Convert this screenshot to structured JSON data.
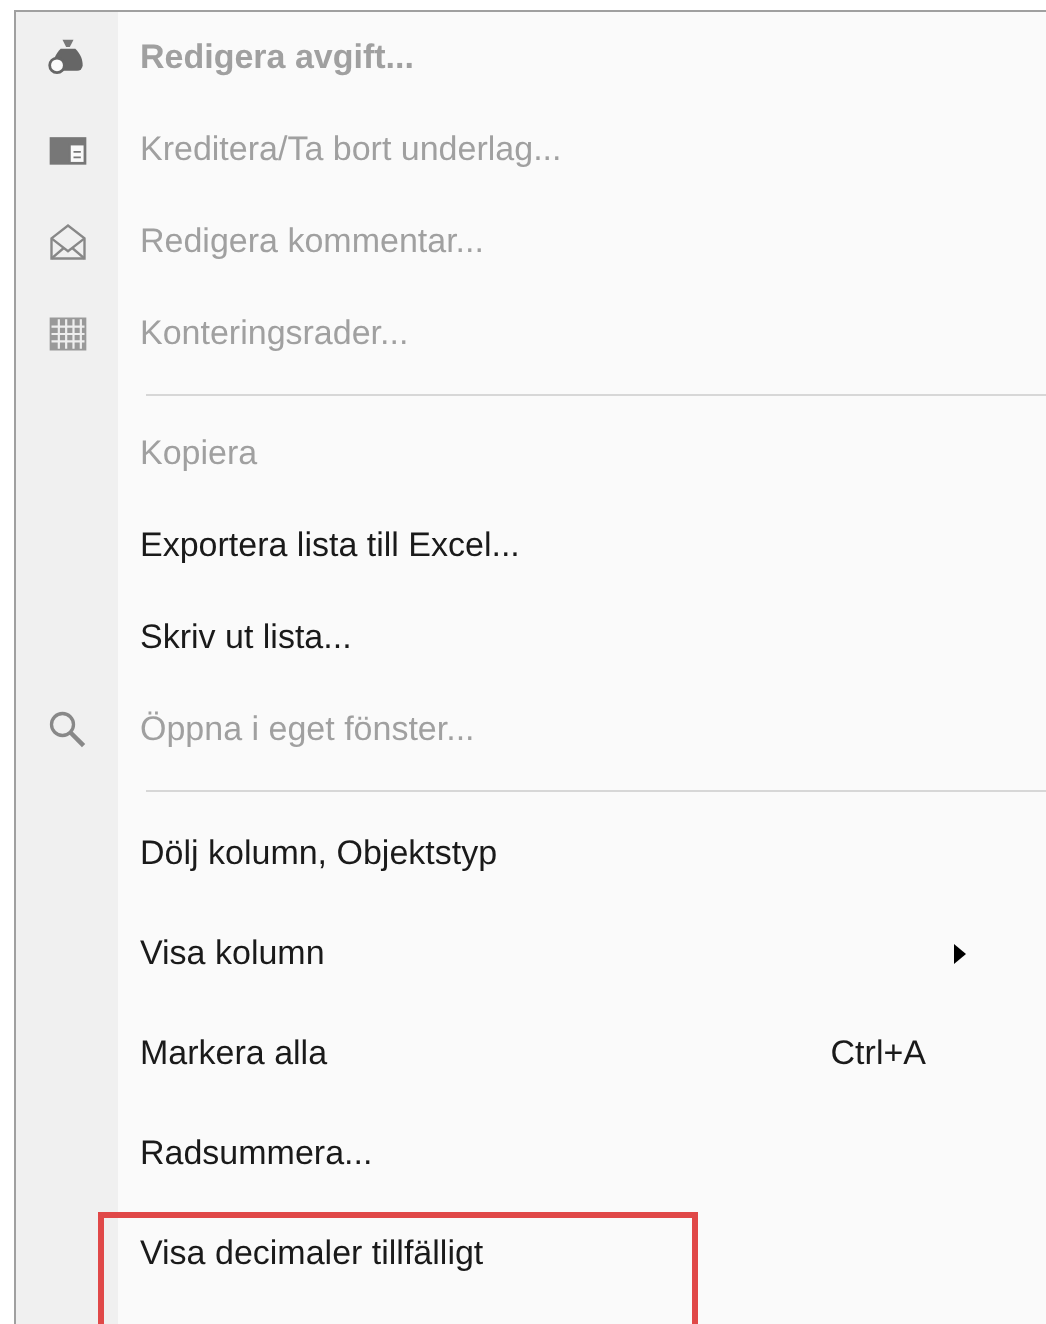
{
  "context_menu": {
    "sections": [
      {
        "items": [
          {
            "label": "Redigera avgift...",
            "disabled": true,
            "bold": true
          },
          {
            "label": "Kreditera/Ta bort underlag...",
            "disabled": true,
            "bold": false
          },
          {
            "label": "Redigera kommentar...",
            "disabled": true,
            "bold": false
          },
          {
            "label": "Konteringsrader...",
            "disabled": true,
            "bold": false
          }
        ]
      },
      {
        "items": [
          {
            "label": "Kopiera",
            "disabled": true,
            "bold": false
          },
          {
            "label": "Exportera lista till Excel...",
            "disabled": false,
            "bold": false
          },
          {
            "label": "Skriv ut lista...",
            "disabled": false,
            "bold": false
          },
          {
            "label": "Öppna i eget fönster...",
            "disabled": true,
            "bold": false
          }
        ]
      },
      {
        "items": [
          {
            "label": "Dölj kolumn, Objektstyp",
            "disabled": false,
            "bold": false
          },
          {
            "label": "Visa kolumn",
            "disabled": false,
            "bold": false,
            "submenu": true
          },
          {
            "label": "Markera alla",
            "shortcut": "Ctrl+A",
            "disabled": false,
            "bold": false
          },
          {
            "label": "Radsummera...",
            "disabled": false,
            "bold": false
          },
          {
            "label": "Visa decimaler tillfälligt",
            "disabled": false,
            "bold": false,
            "highlighted": true
          }
        ]
      }
    ]
  }
}
